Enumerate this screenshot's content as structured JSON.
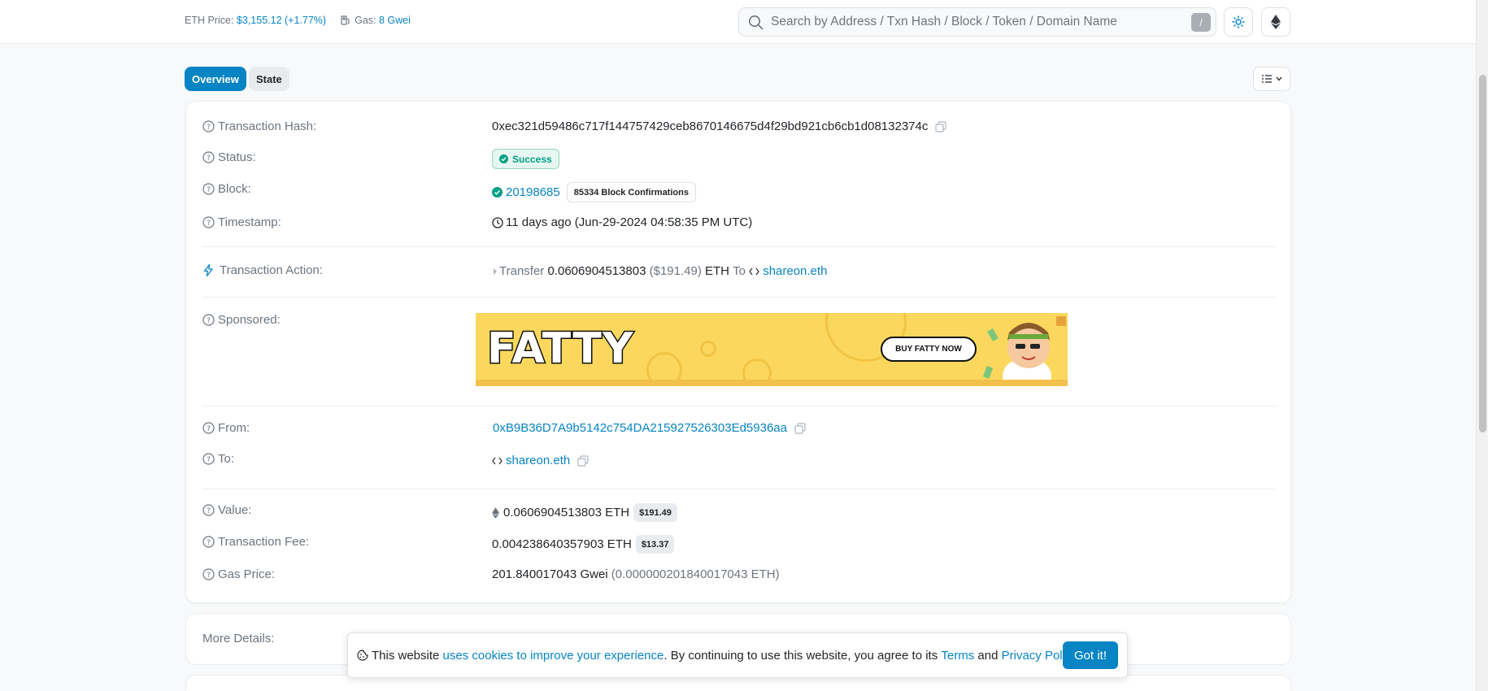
{
  "header": {
    "eth_price_label": "ETH Price:",
    "eth_price_value": "$3,155.12",
    "eth_price_change": "(+1.77%)",
    "gas_label": "Gas:",
    "gas_value": "8 Gwei",
    "search_placeholder": "Search by Address / Txn Hash / Block / Token / Domain Name",
    "search_shortcut": "/"
  },
  "tabs": [
    {
      "label": "Overview",
      "active": true
    },
    {
      "label": "State",
      "active": false
    }
  ],
  "details": {
    "tx_hash_label": "Transaction Hash:",
    "tx_hash": "0xec321d59486c717f144757429ceb8670146675d4f29bd921cb6cb1d08132374c",
    "status_label": "Status:",
    "status": "Success",
    "block_label": "Block:",
    "block": "20198685",
    "confirmations": "85334 Block Confirmations",
    "timestamp_label": "Timestamp:",
    "timestamp": "11 days ago (Jun-29-2024 04:58:35 PM UTC)",
    "action_label": "Transaction Action:",
    "action_verb": "Transfer",
    "action_amount": "0.0606904513803",
    "action_usd": "($191.49)",
    "action_unit": "ETH",
    "action_to": "To",
    "action_dest": "shareon.eth",
    "sponsored_label": "Sponsored:",
    "ad_brand": "FATTY",
    "ad_cta": "BUY FATTY NOW",
    "from_label": "From:",
    "from": "0xB9B36D7A9b5142c754DA215927526303Ed5936aa",
    "to_label": "To:",
    "to": "shareon.eth",
    "value_label": "Value:",
    "value": "0.0606904513803 ETH",
    "value_usd": "$191.49",
    "fee_label": "Transaction Fee:",
    "fee": "0.004238640357903 ETH",
    "fee_usd": "$13.37",
    "gas_price_label": "Gas Price:",
    "gas_price": "201.840017043 Gwei",
    "gas_price_eth": "(0.000000201840017043 ETH)"
  },
  "more_details_label": "More Details:",
  "cookie": {
    "text_before": "This website",
    "link1": "uses cookies to improve your experience",
    "text_mid": ". By continuing to use this website, you agree to its",
    "link_terms": "Terms",
    "text_and": "and",
    "link_privacy": "Privacy Policy",
    "text_end": ".",
    "button": "Got it!"
  },
  "colors": {
    "accent": "#0784c3",
    "success": "#00a186",
    "muted": "#6c757d"
  }
}
